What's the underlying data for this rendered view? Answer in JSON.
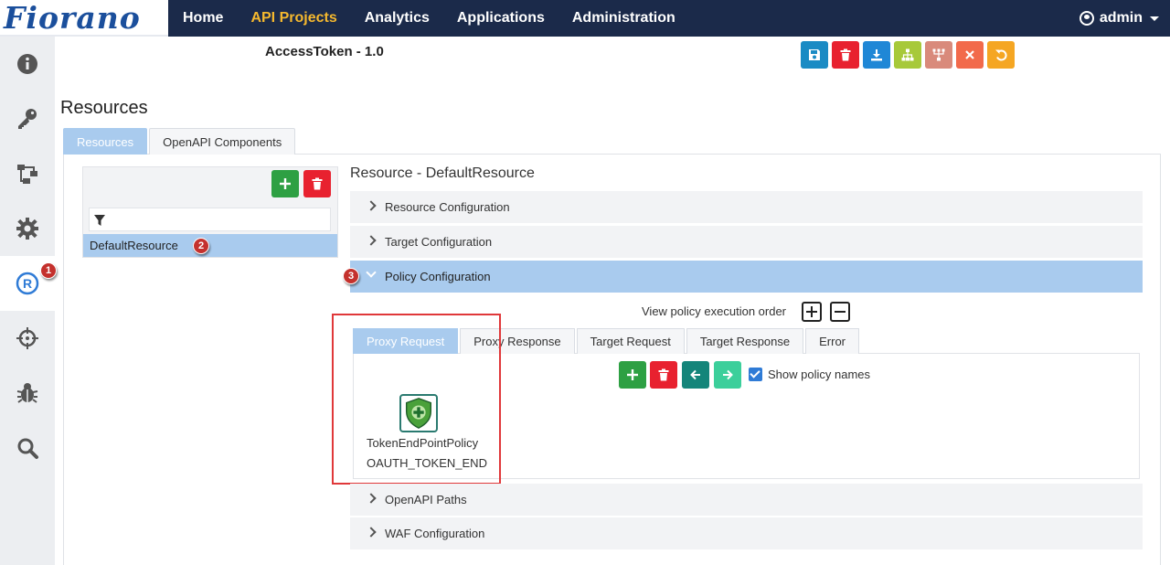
{
  "brand": {
    "logo_text": "Fiorano"
  },
  "nav": {
    "items": [
      {
        "label": "Home",
        "active": false
      },
      {
        "label": "API Projects",
        "active": true
      },
      {
        "label": "Analytics",
        "active": false
      },
      {
        "label": "Applications",
        "active": false
      },
      {
        "label": "Administration",
        "active": false
      }
    ],
    "user": "admin"
  },
  "sidebar": {
    "items": [
      {
        "icon": "info-icon"
      },
      {
        "icon": "key-icon"
      },
      {
        "icon": "flow-icon"
      },
      {
        "icon": "gear-icon"
      },
      {
        "icon": "registered-icon",
        "active": true,
        "badge": "1"
      },
      {
        "icon": "crosshair-icon"
      },
      {
        "icon": "bug-icon"
      },
      {
        "icon": "search-icon"
      }
    ]
  },
  "header": {
    "project_title": "AccessToken - 1.0",
    "toolbar": [
      {
        "icon": "save-icon",
        "color": "#1a8bc4"
      },
      {
        "icon": "trash-icon",
        "color": "#e8212f"
      },
      {
        "icon": "download-icon",
        "color": "#1f87d6"
      },
      {
        "icon": "hierarchy-icon",
        "color": "#a7c93a"
      },
      {
        "icon": "fork-icon",
        "color": "#d98a7b"
      },
      {
        "icon": "close-icon",
        "color": "#f26a4b"
      },
      {
        "icon": "undo-icon",
        "color": "#f5a623"
      }
    ]
  },
  "page": {
    "title": "Resources",
    "tabs": [
      {
        "label": "Resources",
        "active": true
      },
      {
        "label": "OpenAPI Components",
        "active": false
      }
    ]
  },
  "resources": {
    "filter_placeholder": "",
    "items": [
      {
        "label": "DefaultResource",
        "badge": "2"
      }
    ]
  },
  "resource_detail": {
    "heading": "Resource - DefaultResource",
    "sections": [
      {
        "label": "Resource Configuration",
        "open": false
      },
      {
        "label": "Target Configuration",
        "open": false
      },
      {
        "label": "Policy Configuration",
        "open": true,
        "badge": "3"
      },
      {
        "label": "OpenAPI Paths",
        "open": false
      },
      {
        "label": "WAF Configuration",
        "open": false
      }
    ],
    "exec_order_label": "View policy execution order",
    "policy_tabs": [
      {
        "label": "Proxy Request",
        "active": true
      },
      {
        "label": "Proxy Response",
        "active": false
      },
      {
        "label": "Target Request",
        "active": false
      },
      {
        "label": "Target Response",
        "active": false
      },
      {
        "label": "Error",
        "active": false
      }
    ],
    "show_policy_names_label": "Show policy names",
    "show_policy_names": true,
    "policy": {
      "name": "TokenEndPointPolicy",
      "type": "OAUTH_TOKEN_END"
    }
  },
  "colors": {
    "nav_bg": "#1b2a4a",
    "nav_active": "#f5b82e",
    "selected_bg": "#a9cbee",
    "add_green": "#2ea043",
    "delete_red": "#e8212f",
    "teal": "#14857a",
    "light_teal": "#3ccf9b",
    "annotation_red": "#e0383a"
  }
}
